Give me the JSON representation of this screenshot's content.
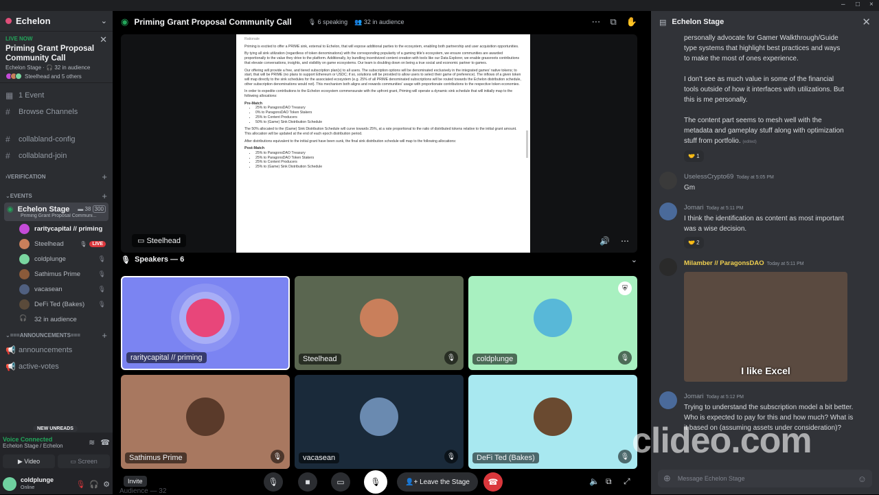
{
  "app": {
    "window_controls": [
      "–",
      "□",
      "×"
    ]
  },
  "server": {
    "name": "Echelon"
  },
  "live": {
    "tag": "LIVE NOW",
    "title": "Priming Grant Proposal Community Call",
    "sub": "Echelon Stage · 🎧 32 in audience",
    "people": "Steelhead and 5 others"
  },
  "channels": {
    "event": "1 Event",
    "browse": "Browse Channels",
    "c1": "collabland-config",
    "c2": "collabland-join"
  },
  "categories": {
    "verification": "VERIFICATION",
    "events": "EVENTS",
    "announcements": "===ANNOUNCEMENTS===",
    "new_unreads": "NEW UNREADS"
  },
  "stage_channel": {
    "name": "Echelon Stage",
    "count1": "38",
    "count2": "300",
    "sub": "Priming Grant Proposal Communi..."
  },
  "members": [
    {
      "name": "raritycapital // priming",
      "color": "#c44bd8"
    },
    {
      "name": "Steelhead",
      "color": "#c97f5b",
      "live": "LIVE"
    },
    {
      "name": "coldplunge",
      "color": "#7ad6a0"
    },
    {
      "name": "Sathimus Prime",
      "color": "#8a5a3a"
    },
    {
      "name": "vacasean",
      "color": "#506080"
    },
    {
      "name": "DeFi Ted (Bakes)",
      "color": "#5a4a3a"
    },
    {
      "name": "32 in audience",
      "color": ""
    }
  ],
  "ann_channels": {
    "a1": "announcements",
    "a2": "active-votes"
  },
  "voice": {
    "title": "Voice Connected",
    "sub": "Echelon Stage / Echelon",
    "video": "Video",
    "screen": "Screen"
  },
  "user": {
    "name": "coldplunge",
    "status": "Online"
  },
  "stage": {
    "title": "Priming Grant Proposal Community Call",
    "speaking": "6 speaking",
    "audience": "32 in audience",
    "share_label": "Steelhead",
    "speakers": "Speakers — 6",
    "audience_hdr": "Audience — 32",
    "invite": "Invite",
    "leave": "Leave the Stage"
  },
  "doc": {
    "p0": "Rationale",
    "p1": "Priming is excited to offer a PRIME sink, external to Echelon, that will expose additional parties to the ecosystem, enabling both partnership and user acquisition opportunities.",
    "p2": "By tying all sink utilization (regardless of token denominations) with the corresponding popularity of a gaming title's ecosystem, we ensure communities are awarded proportionally to the value they drive to the platform. Additionally, by bundling incentivized content creation with tools like our Data Explorer, we enable grassroots contributions that elevate conversations, insights, and visibility on game ecosystems. Our team is doubling down on being a true social and economic partner to games.",
    "p3": "Our offering will provide a free, and tiered subscription plan(s) to all users. The subscription options will be denominated exclusively in the integrated games' native tokens; to start, that will be PRIME (no plans to support Ethereum or USDC; if so, solutions will be provided to allow users to select their game of preference). The inflows of a given token will map directly to the sink schedules for the associated ecosystem (e.g. 25% of all PRIME denominated subscriptions will be routed towards the Echelon distribution schedule, other subscription denominations would not). This mechanism both aligns and rewards communities' usage with proportionate contributions to the respective token economies.",
    "p4": "In order to expedite contributions to the Echelon ecosystem commensurate with the upfront grant, Priming will operate a dynamic sink schedule that will initially map to the following allocations:",
    "h1": "Pre-Match",
    "l1": [
      "25% to ParagonsDAO Treasury",
      "0% to ParagonsDAO Token Stakers",
      "25% to Content Producers",
      "50% to (Game) Sink Distribution Schedule"
    ],
    "p5": "The 50% allocated to the (Game) Sink Distribution Schedule will curve towards 25%, at a rate proportional to the ratio of distributed tokens relative to the initial grant amount. This allocation will be updated at the end of each epoch distribution period.",
    "p6": "After distributions equivalent to the initial grant have been sunk, the final sink distribution schedule will map to the following allocations:",
    "h2": "Post-Match",
    "l2": [
      "25% to ParagonsDAO Treasury",
      "25% to ParagonsDAO Token Stakers",
      "25% to Content Producers",
      "25% to (Game) Sink Distribution Schedule"
    ]
  },
  "tiles": [
    {
      "name": "raritycapital // priming",
      "bg": "#7b84f2",
      "av": "#e8467a"
    },
    {
      "name": "Steelhead",
      "bg": "#5a6650",
      "av": "#c97f5b"
    },
    {
      "name": "coldplunge",
      "bg": "#a8f0c0",
      "av": "#58b8d8"
    },
    {
      "name": "Sathimus Prime",
      "bg": "#a87860",
      "av": "#5a3a2a"
    },
    {
      "name": "vacasean",
      "bg": "#1a2a3a",
      "av": "#6a8ab0"
    },
    {
      "name": "DeFi Ted (Bakes)",
      "bg": "#a8e8f0",
      "av": "#6a4a30"
    }
  ],
  "chat": {
    "title": "Echelon Stage",
    "cont1": "personally advocate for Gamer Walkthrough/Guide type systems that highlight best practices and ways to make the most of ones experience.",
    "cont2": "I don't see as much value in some of the financial tools outside of how it interfaces with utilizations. But this is me personally.",
    "cont3": "The content part seems to mesh well with the metadata and gameplay stuff along with optimization stuff from portfolio.",
    "edited": "(edited)",
    "react1": "🤝 1",
    "messages": [
      {
        "name": "UselessCrypto69",
        "time": "Today at 5:05 PM",
        "text": "Gm",
        "color": "#949ba4"
      },
      {
        "name": "Jomari",
        "time": "Today at 5:11 PM",
        "text": "I think the identification as content as most important was a wise decision.",
        "react": "🤝 2",
        "color": "#949ba4"
      },
      {
        "name": "Milamber // ParagonsDAO",
        "time": "Today at 5:11 PM",
        "text": "",
        "gif": "I like Excel",
        "color": "#f0d050"
      },
      {
        "name": "Jomari",
        "time": "Today at 5:12 PM",
        "text": "Trying to understand the subscription model a bit better. Who is expected to pay for this and how much? What is it based on (assuming assets under consideration)?",
        "color": "#949ba4"
      }
    ],
    "input_placeholder": "Message Echelon Stage"
  },
  "watermark": "clideo.com"
}
